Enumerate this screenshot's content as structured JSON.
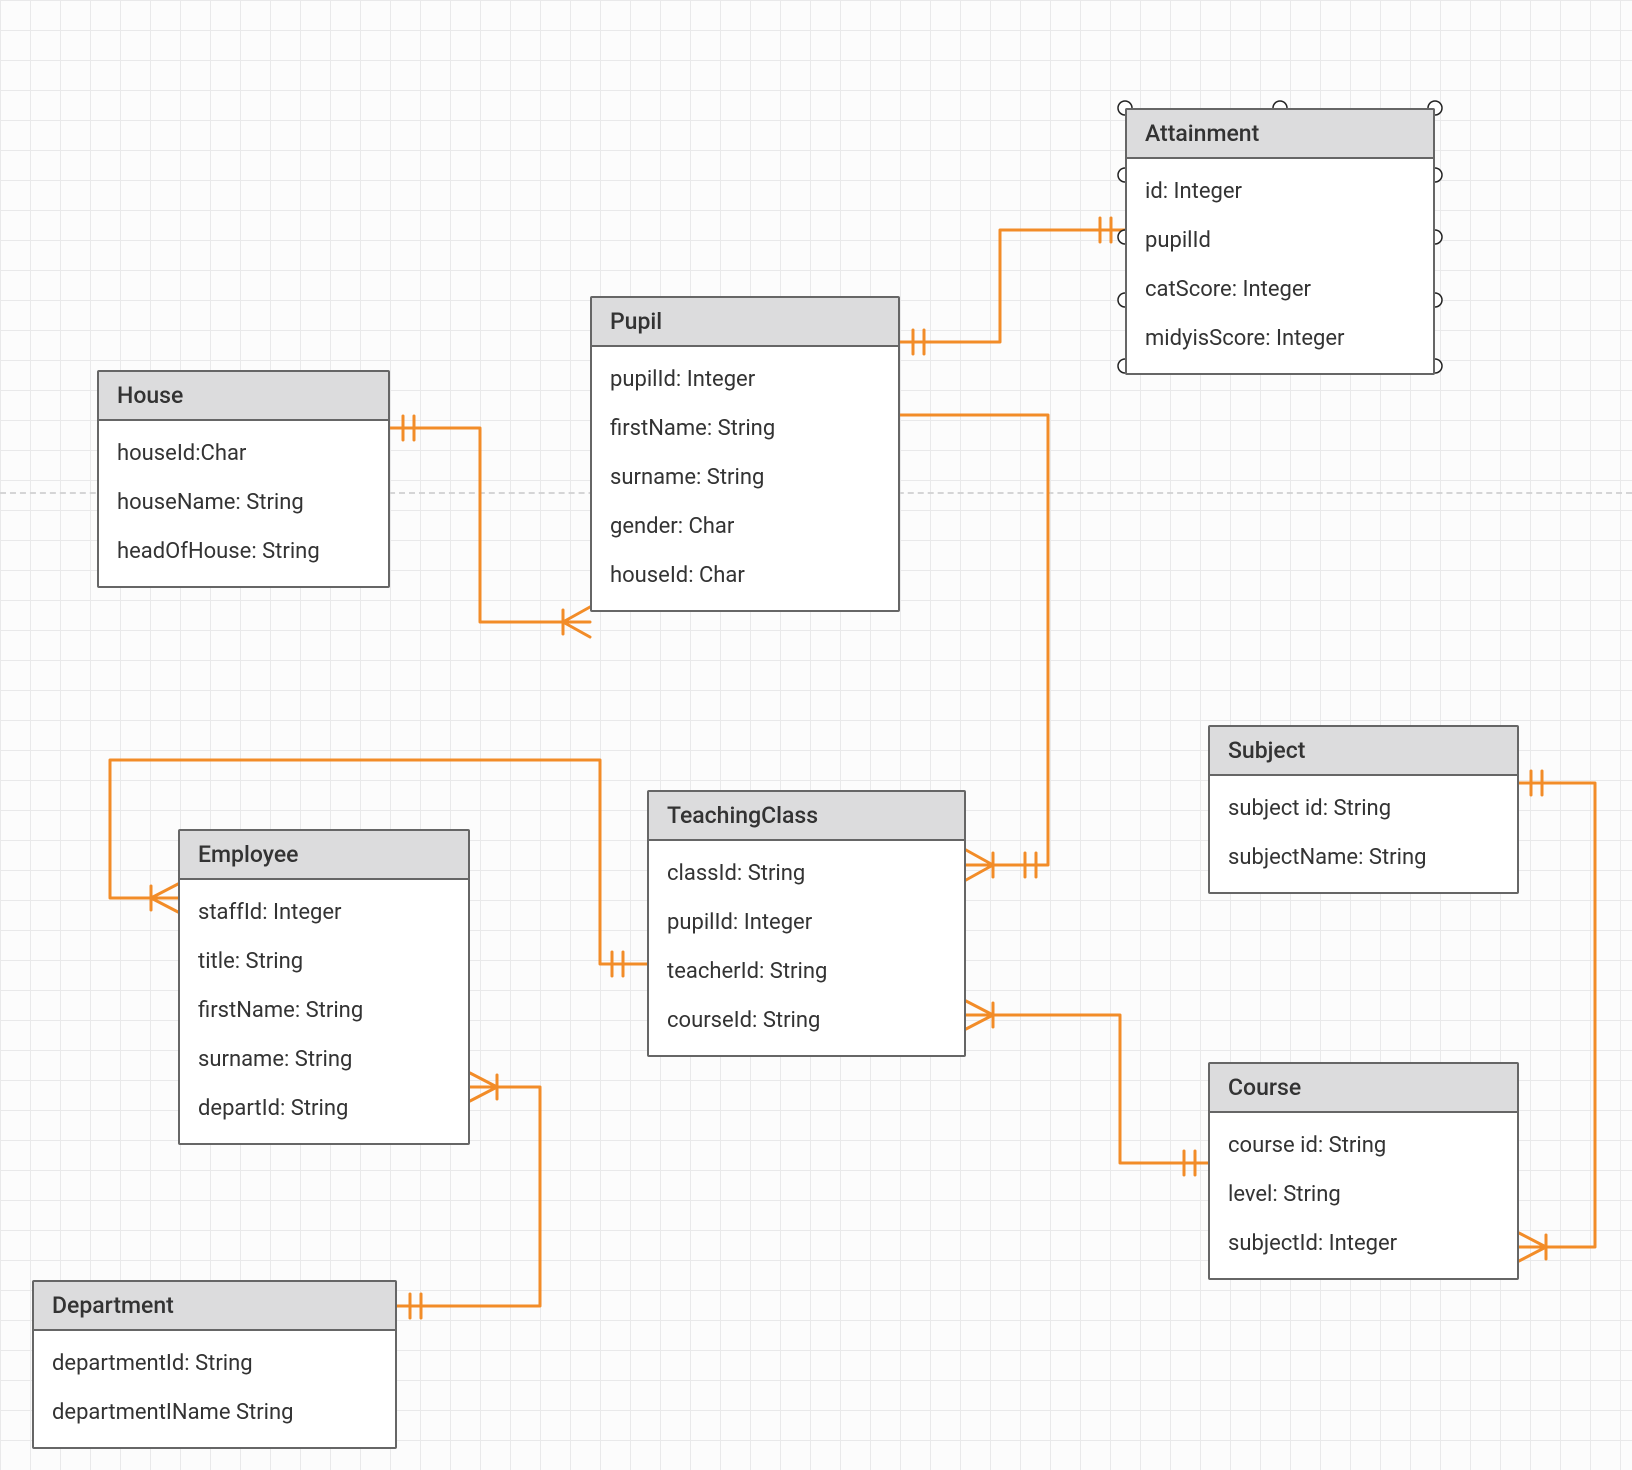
{
  "entities": {
    "house": {
      "title": "House",
      "attrs": [
        "houseId:Char",
        "houseName: String",
        "headOfHouse: String"
      ]
    },
    "pupil": {
      "title": "Pupil",
      "attrs": [
        "pupilId: Integer",
        "firstName: String",
        "surname: String",
        "gender: Char",
        "houseId: Char"
      ]
    },
    "attainment": {
      "title": "Attainment",
      "attrs": [
        "id: Integer",
        "pupilId",
        "catScore: Integer",
        "midyisScore: Integer"
      ]
    },
    "teachingclass": {
      "title": "TeachingClass",
      "attrs": [
        "classId: String",
        "pupilId: Integer",
        "teacherId: String",
        "courseId: String"
      ]
    },
    "employee": {
      "title": "Employee",
      "attrs": [
        "staffId: Integer",
        "title: String",
        "firstName: String",
        "surname: String",
        "departId: String"
      ]
    },
    "department": {
      "title": "Department",
      "attrs": [
        "departmentId: String",
        "departmentIName String"
      ]
    },
    "subject": {
      "title": "Subject",
      "attrs": [
        "subject id: String",
        "subjectName: String"
      ]
    },
    "course": {
      "title": "Course",
      "attrs": [
        "course id: String",
        "level: String",
        "subjectId: Integer"
      ]
    }
  },
  "colors": {
    "connector": "#F28C28",
    "connector_stroke_width": 3
  },
  "relationships": [
    {
      "from": "House",
      "to": "Pupil",
      "from_card": "one",
      "to_card": "many"
    },
    {
      "from": "Pupil",
      "to": "Attainment",
      "from_card": "one",
      "to_card": "one"
    },
    {
      "from": "Pupil",
      "to": "TeachingClass",
      "from_card": "one",
      "to_card": "many"
    },
    {
      "from": "Employee",
      "to": "TeachingClass",
      "from_card": "one",
      "to_card": "many"
    },
    {
      "from": "Department",
      "to": "Employee",
      "from_card": "one",
      "to_card": "many"
    },
    {
      "from": "Course",
      "to": "TeachingClass",
      "from_card": "one",
      "to_card": "many"
    },
    {
      "from": "Subject",
      "to": "Course",
      "from_card": "one",
      "to_card": "many"
    }
  ]
}
